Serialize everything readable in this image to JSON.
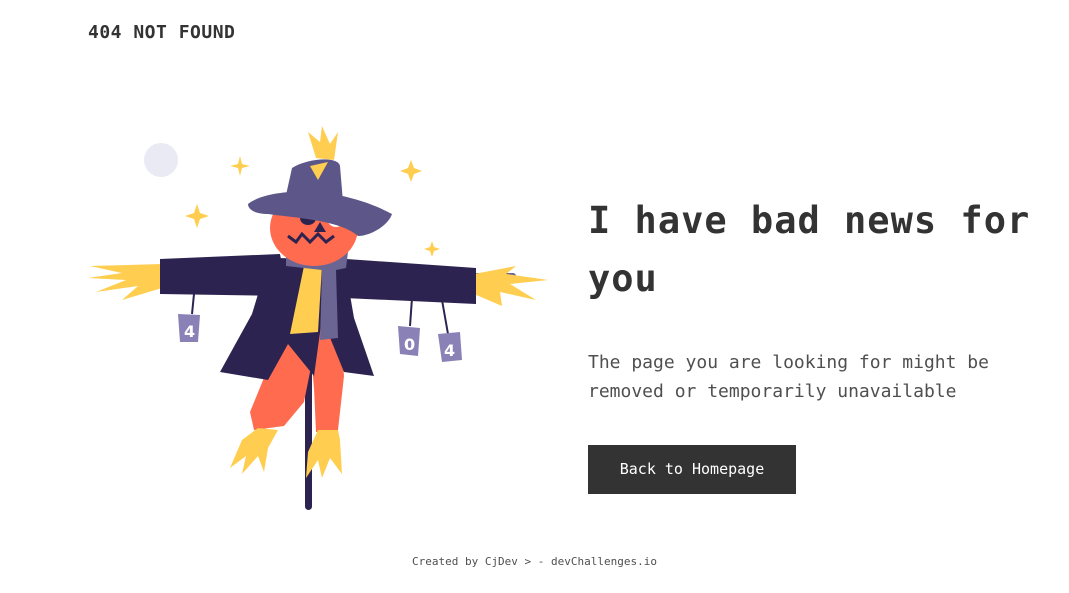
{
  "header": {
    "brand": "404 NOT FOUND"
  },
  "illustration": {
    "can_labels": [
      "4",
      "0",
      "4"
    ],
    "colors": {
      "hat": "#5d5789",
      "coat": "#2d2350",
      "face": "#ff6b4f",
      "straw": "#ffcd4f",
      "can": "#8a81b6",
      "moon": "#e9eaf4"
    }
  },
  "main": {
    "headline": "I have bad news for you",
    "message": "The page you are looking for might be removed or temporarily unavailable",
    "cta_label": "Back to Homepage"
  },
  "footer": {
    "credit": "Created by CjDev > - devChallenges.io"
  },
  "theme": {
    "text": "#333333",
    "muted": "#4f4f4f",
    "button_bg": "#333333",
    "button_text": "#ffffff"
  }
}
